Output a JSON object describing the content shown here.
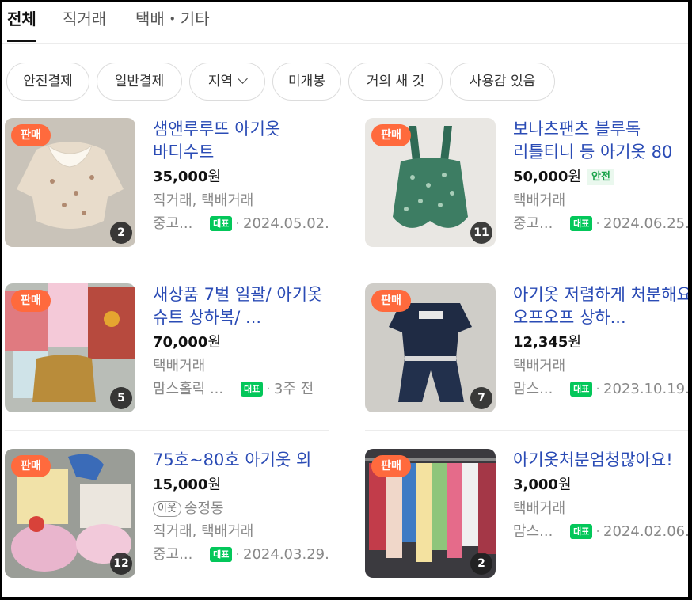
{
  "tabs": [
    {
      "label": "전체",
      "active": true
    },
    {
      "label": "직거래",
      "active": false
    },
    {
      "label": "택배・기타",
      "active": false
    }
  ],
  "filters": [
    {
      "label": "안전결제"
    },
    {
      "label": "일반결제"
    },
    {
      "label": "지역",
      "dropdown": true
    },
    {
      "label": "미개봉"
    },
    {
      "label": "거의 새 것"
    },
    {
      "label": "사용감 있음"
    }
  ],
  "sale_badge": "판매",
  "naver_badge": "대표",
  "safe_badge": "안전",
  "colors": {
    "accent_blue": "#2a4bb5",
    "sale_orange": "#ff6a3d",
    "naver_green": "#03c75a"
  },
  "products": [
    {
      "title": "샘앤루루뜨 아기옷 바디수트",
      "price": "35,000",
      "unit": "원",
      "trade": "직거래, 택배거래",
      "source": "중고...",
      "date": "2024.05.02.",
      "photos": "2"
    },
    {
      "title": "보나츠팬츠 블루독 리틀티니 등 아기옷 80",
      "price": "50,000",
      "unit": "원",
      "safe": true,
      "trade": "택배거래",
      "source": "중고...",
      "date": "2024.06.25."
    },
    {
      "title": "새상품 7벌 일괄/ 아기옷 슈트 상하복/ ...",
      "price": "70,000",
      "unit": "원",
      "trade": "택배거래",
      "source": "맘스홀릭 ...",
      "date": "3주 전",
      "photos": "5"
    },
    {
      "title": "아기옷 저렴하게 처분해요 오프오프 상하...",
      "price": "12,345",
      "unit": "원",
      "trade": "택배거래",
      "source": "맘스...",
      "date": "2023.10.19.",
      "photos": "7"
    },
    {
      "title": "75호~80호 아기옷 외",
      "price": "15,000",
      "unit": "원",
      "neighbor_tag": "이웃",
      "location": "송정동",
      "trade": "직거래, 택배거래",
      "source": "중고...",
      "date": "2024.03.29.",
      "photos": "12"
    },
    {
      "title": "아기옷처분엄청많아요!",
      "price": "3,000",
      "unit": "원",
      "trade": "택배거래",
      "source": "맘스...",
      "date": "2024.02.06.",
      "photos": "2"
    }
  ],
  "second_photo_count": "11"
}
